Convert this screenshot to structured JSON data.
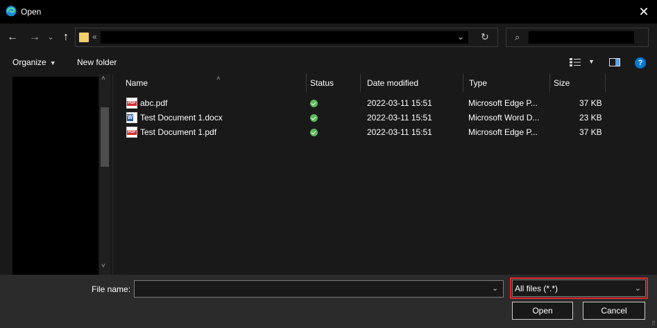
{
  "window": {
    "title": "Open",
    "close_glyph": "✕",
    "app_icon": "edge-browser-icon"
  },
  "nav": {
    "back_glyph": "←",
    "forward_glyph": "→",
    "recent_glyph": "⌄",
    "up_glyph": "↑",
    "address_chevron": "«",
    "address_dropdown_glyph": "⌄",
    "refresh_glyph": "↻",
    "search_glyph": "⌕"
  },
  "toolbar": {
    "organize_label": "Organize",
    "organize_caret": "▼",
    "new_folder_label": "New folder",
    "view_caret": "▼",
    "help_glyph": "?"
  },
  "leftpane": {
    "scroll_up_glyph": "˄",
    "scroll_down_glyph": "˅"
  },
  "filelist": {
    "sort_glyph": "˄",
    "columns": [
      "Name",
      "Status",
      "Date modified",
      "Type",
      "Size"
    ],
    "rows": [
      {
        "name": "abc.pdf",
        "icon": "pdf-icon",
        "status": "synced-icon",
        "date": "2022-03-11 15:51",
        "type": "Microsoft Edge P...",
        "size": "37 KB"
      },
      {
        "name": "Test Document 1.docx",
        "icon": "word-icon",
        "status": "synced-icon",
        "date": "2022-03-11 15:51",
        "type": "Microsoft Word D...",
        "size": "23 KB"
      },
      {
        "name": "Test Document 1.pdf",
        "icon": "pdf-icon",
        "status": "synced-icon",
        "date": "2022-03-11 15:51",
        "type": "Microsoft Edge P...",
        "size": "37 KB"
      }
    ]
  },
  "bottom": {
    "file_name_label": "File name:",
    "file_name_value": "",
    "file_name_dropdown_glyph": "⌄",
    "filter_value": "All files (*.*)",
    "filter_dropdown_glyph": "⌄",
    "open_label": "Open",
    "cancel_label": "Cancel",
    "grip_glyph": "⠿"
  },
  "colors": {
    "highlight": "#e3262b",
    "accent": "#0078d4",
    "status_ok": "#5cb85c"
  }
}
